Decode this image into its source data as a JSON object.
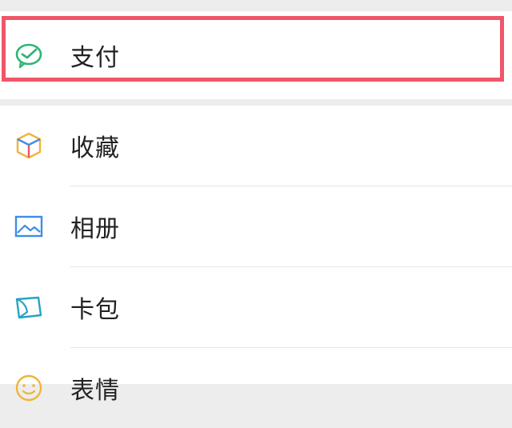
{
  "menu": {
    "pay": {
      "label": "支付",
      "icon": "wechat-pay-icon",
      "highlight_color": "#f0566a"
    },
    "items": [
      {
        "label": "收藏",
        "icon": "favorites-cube-icon"
      },
      {
        "label": "相册",
        "icon": "album-picture-icon"
      },
      {
        "label": "卡包",
        "icon": "card-wallet-icon"
      },
      {
        "label": "表情",
        "icon": "sticker-smiley-icon"
      }
    ]
  },
  "colors": {
    "pay_green": "#2bb673",
    "album_blue": "#3e8ee8",
    "card_teal": "#27a3c4",
    "sticker_yellow": "#f2b43a"
  }
}
